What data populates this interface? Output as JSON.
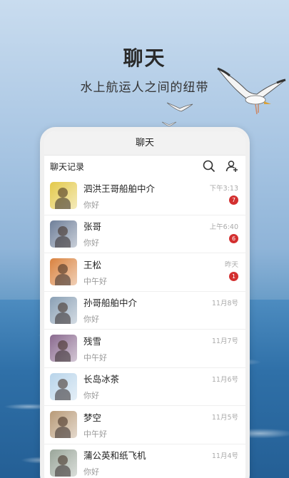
{
  "hero": {
    "title": "聊天",
    "subtitle": "水上航运人之间的纽带"
  },
  "app": {
    "window_title": "聊天",
    "section_label": "聊天记录",
    "icons": [
      "search-icon",
      "add-contact-icon"
    ]
  },
  "colors": {
    "badge": "#d32f2f",
    "sky": "#a9c6e3",
    "sea": "#2f70a8"
  },
  "chats": [
    {
      "name": "泗洪王哥船舶中介",
      "message": "你好",
      "time": "下午3:13",
      "badge": "7",
      "avatar_color": "#e3c94a"
    },
    {
      "name": "张哥",
      "message": "你好",
      "time": "上午6:40",
      "badge": "6",
      "avatar_color": "#6f7f99"
    },
    {
      "name": "王松",
      "message": "中午好",
      "time": "昨天",
      "badge": "1",
      "avatar_color": "#d9823f"
    },
    {
      "name": "孙哥船舶中介",
      "message": "你好",
      "time": "11月8号",
      "badge": "",
      "avatar_color": "#8aa0b5"
    },
    {
      "name": "残雪",
      "message": "中午好",
      "time": "11月7号",
      "badge": "",
      "avatar_color": "#8a6a8f"
    },
    {
      "name": "长岛冰茶",
      "message": "你好",
      "time": "11月6号",
      "badge": "",
      "avatar_color": "#b8d4ea"
    },
    {
      "name": "梦空",
      "message": "中午好",
      "time": "11月5号",
      "badge": "",
      "avatar_color": "#b89a78"
    },
    {
      "name": "蒲公英和纸飞机",
      "message": "你好",
      "time": "11月4号",
      "badge": "",
      "avatar_color": "#9aa69a"
    }
  ]
}
